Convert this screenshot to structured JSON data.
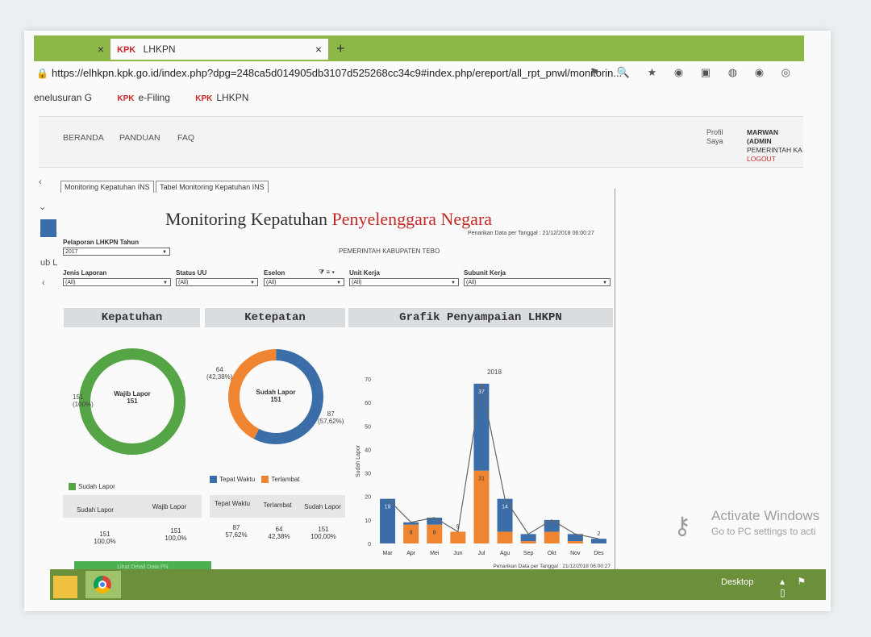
{
  "browser": {
    "tab1_close": "×",
    "tab2_logo": "KPK",
    "tab2_title": "LHKPN",
    "tab2_close": "×",
    "new_tab": "+",
    "url": "https://elhkpn.kpk.go.id/index.php?dpg=248ca5d014905db3107d525268cc34c9#index.php/ereport/all_rpt_pnwl/monitorin...",
    "bookmarks": [
      {
        "logo": "",
        "label": "enelusuran G"
      },
      {
        "logo": "KPK",
        "label": "e-Filing"
      },
      {
        "logo": "KPK",
        "label": "LHKPN"
      }
    ]
  },
  "nav": {
    "items": [
      "BERANDA",
      "PANDUAN",
      "FAQ"
    ],
    "profile_alt": "Profil Saya",
    "user_name": "MARWAN (ADMIN",
    "user_org": "PEMERINTAH KA",
    "logout": "LOGOUT"
  },
  "content_tabs": [
    "Monitoring Kepatuhan INS",
    "Tabel Monitoring Kepatuhan INS"
  ],
  "page": {
    "title_a": "Monitoring Kepatuhan",
    "title_b": "Penyelenggara Negara",
    "timestamp": "Penarikan Data per Tanggal : 21/12/2018 06:00:27",
    "org": "PEMERINTAH KABUPATEN TEBO"
  },
  "filters": {
    "year_label": "Pelaporan LHKPN Tahun",
    "year_value": "2017",
    "jenis_label": "Jenis Laporan",
    "jenis_value": "(All)",
    "status_label": "Status UU",
    "status_value": "(All)",
    "eselon_label": "Eselon",
    "eselon_value": "(All)",
    "unit_label": "Unit Kerja",
    "unit_value": "(All)",
    "subunit_label": "Subunit Kerja",
    "subunit_value": "(All)"
  },
  "kepatuhan": {
    "header": "Kepatuhan",
    "center_label": "Wajib Lapor",
    "center_value": "151",
    "outer_value": "151",
    "outer_pct": "(100%)",
    "legend": "Sudah Lapor",
    "col1": "Sudah Lapor",
    "col2": "Wajib Lapor",
    "v1": "151",
    "p1": "100,0%",
    "v2": "151",
    "p2": "100,0%",
    "button": "Lihat Detail Data PN"
  },
  "ketepatan": {
    "header": "Ketepatan",
    "center_label": "Sudah Lapor",
    "center_value": "151",
    "late_value": "64",
    "late_pct": "(42,38%)",
    "ontime_value": "87",
    "ontime_pct": "(57,62%)",
    "legend_ontime": "Tepat Waktu",
    "legend_late": "Terlambat",
    "col1": "Tepat Waktu",
    "col2": "Terlambat",
    "col3": "Sudah Lapor",
    "v1": "87",
    "p1": "57,62%",
    "v2": "64",
    "p2": "42,38%",
    "v3": "151",
    "p3": "100,00%"
  },
  "chart_data": {
    "type": "bar",
    "title": "Grafik Penyampaian LHKPN",
    "subtitle": "2018",
    "ylabel": "Sudah Lapor",
    "ylim": [
      0,
      70
    ],
    "yticks": [
      0,
      10,
      20,
      30,
      40,
      50,
      60,
      70
    ],
    "categories": [
      "Mar",
      "Apr",
      "Mei",
      "Jun",
      "Jul",
      "Agu",
      "Sep",
      "Okt",
      "Nov",
      "Des"
    ],
    "series": [
      {
        "name": "Tepat Waktu",
        "color": "#3b6ea8",
        "values": [
          19,
          1,
          3,
          0,
          37,
          14,
          3,
          5,
          3,
          2
        ]
      },
      {
        "name": "Terlambat",
        "color": "#ef8531",
        "values": [
          0,
          8,
          8,
          5,
          31,
          5,
          1,
          5,
          1,
          0
        ]
      }
    ],
    "data_labels": [
      {
        "x": "Mar",
        "series": "Tepat Waktu",
        "text": "19"
      },
      {
        "x": "Apr",
        "series": "Terlambat",
        "text": "8"
      },
      {
        "x": "Mei",
        "series": "Terlambat",
        "text": "8"
      },
      {
        "x": "Jun",
        "series": "Terlambat",
        "text": "5"
      },
      {
        "x": "Jul",
        "series": "Tepat Waktu",
        "text": "37"
      },
      {
        "x": "Jul",
        "series": "Terlambat",
        "text": "31"
      },
      {
        "x": "Agu",
        "series": "Tepat Waktu",
        "text": "14"
      },
      {
        "x": "Des",
        "series": "Tepat Waktu",
        "text": "2"
      }
    ],
    "footer": "Penarikan Data per Tanggal : 21/12/2018 06:00:27"
  },
  "kepatuhan_chart": {
    "slices": [
      {
        "name": "Sudah Lapor",
        "value": 151,
        "color": "#55a546"
      }
    ]
  },
  "ketepatan_chart": {
    "slices": [
      {
        "name": "Tepat Waktu",
        "value": 87,
        "color": "#3b6ea8"
      },
      {
        "name": "Terlambat",
        "value": 64,
        "color": "#ef8531"
      }
    ]
  },
  "windows": {
    "activate_title": "Activate Windows",
    "activate_sub": "Go to PC settings to acti",
    "desktop": "Desktop"
  }
}
